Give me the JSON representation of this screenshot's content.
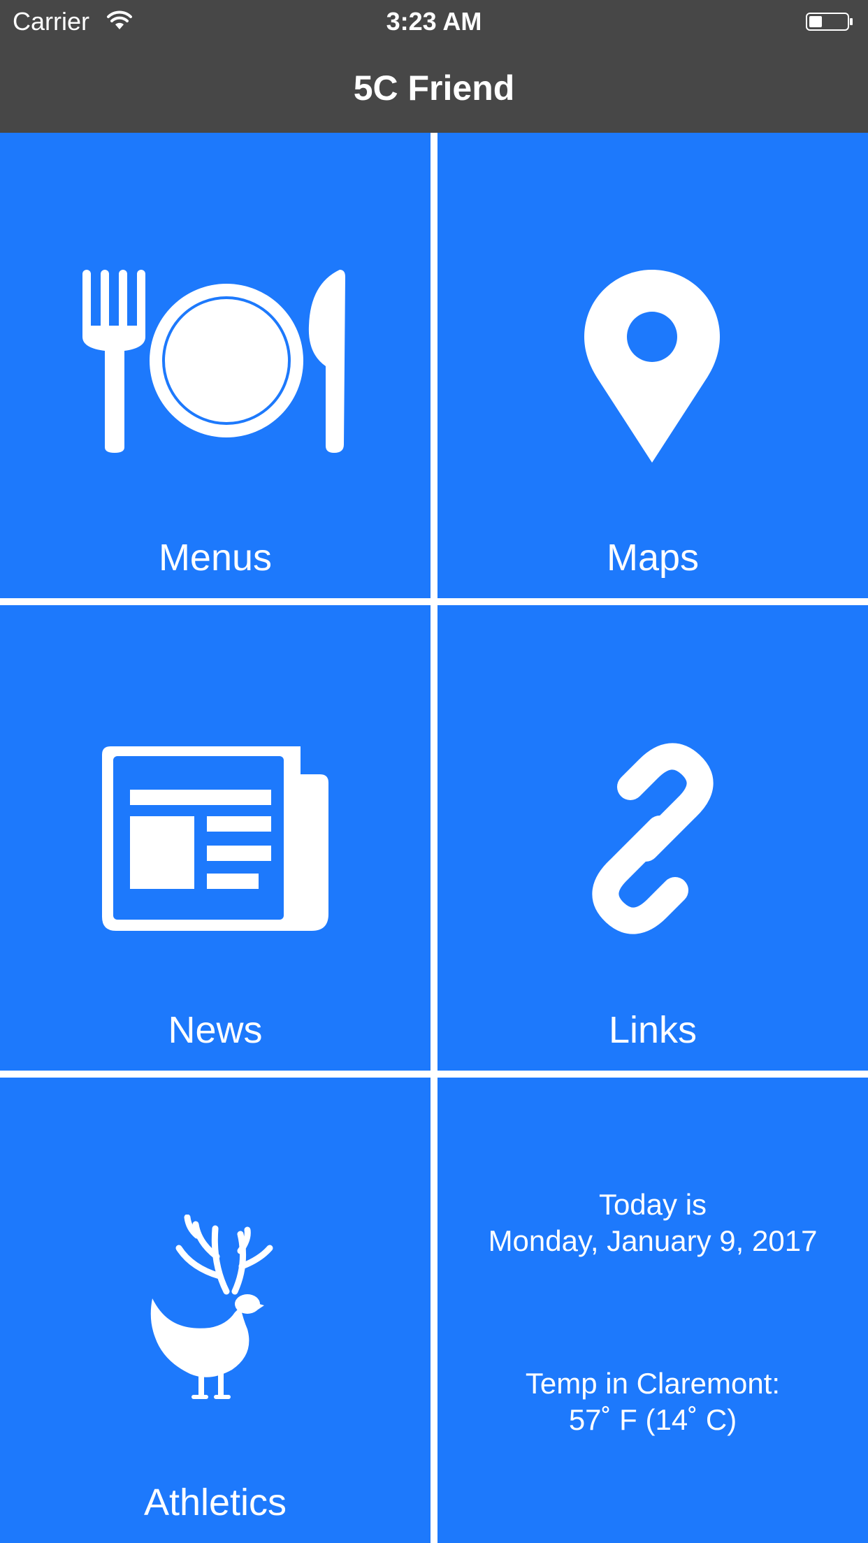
{
  "status_bar": {
    "carrier": "Carrier",
    "time": "3:23 AM",
    "icons": [
      "wifi-icon",
      "battery-icon"
    ]
  },
  "nav": {
    "title": "5C Friend"
  },
  "tiles": [
    {
      "label": "Menus",
      "icon": "dining-plate-icon"
    },
    {
      "label": "Maps",
      "icon": "map-pin-icon"
    },
    {
      "label": "News",
      "icon": "newspaper-icon"
    },
    {
      "label": "Links",
      "icon": "chain-link-icon"
    },
    {
      "label": "Athletics",
      "icon": "stag-hen-mascot-icon"
    }
  ],
  "info": {
    "today_label": "Today is",
    "date": "Monday, January 9, 2017",
    "temp_label": "Temp in Claremont:",
    "temp_value": "57˚ F (14˚ C)"
  },
  "colors": {
    "tile": "#1d79fc",
    "bar": "#474747",
    "divider": "#ffffff"
  }
}
